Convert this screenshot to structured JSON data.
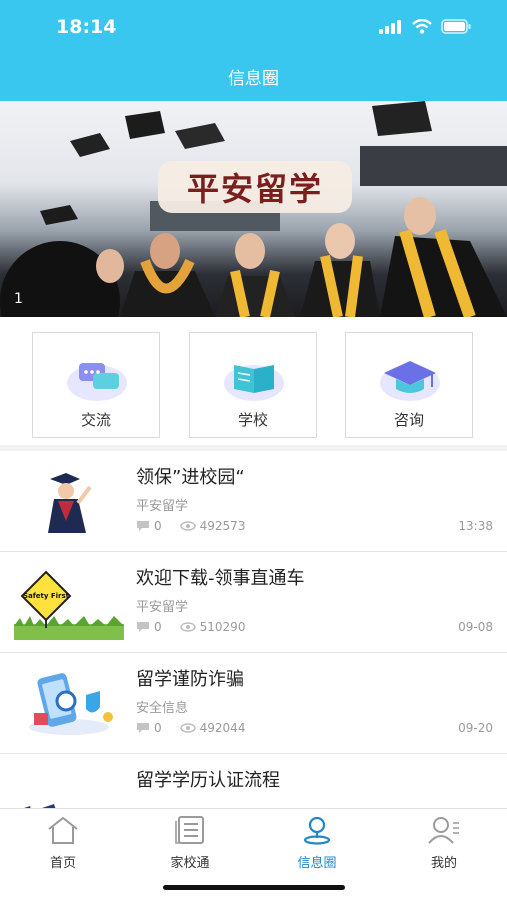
{
  "status": {
    "time": "18:14"
  },
  "header": {
    "title": "信息圈"
  },
  "banner": {
    "text": "平安留学",
    "index": "1"
  },
  "quick": [
    {
      "label": "交流",
      "icon": "chat-icon"
    },
    {
      "label": "学校",
      "icon": "book-icon"
    },
    {
      "label": "咨询",
      "icon": "graduation-cap-icon"
    }
  ],
  "news": [
    {
      "title": "领保”进校园“",
      "source": "平安留学",
      "comments": "0",
      "views": "492573",
      "date": "13:38"
    },
    {
      "title": "欢迎下载-领事直通车",
      "source": "平安留学",
      "comments": "0",
      "views": "510290",
      "date": "09-08"
    },
    {
      "title": "留学谨防诈骗",
      "source": "安全信息",
      "comments": "0",
      "views": "492044",
      "date": "09-20"
    },
    {
      "title": "留学学历认证流程",
      "source": "",
      "comments": "",
      "views": "",
      "date": ""
    }
  ],
  "thumb_texts": {
    "safety": "Safety First"
  },
  "tabs": [
    {
      "label": "首页",
      "icon": "home-icon"
    },
    {
      "label": "家校通",
      "icon": "document-icon"
    },
    {
      "label": "信息圈",
      "icon": "location-icon",
      "active": true
    },
    {
      "label": "我的",
      "icon": "profile-icon"
    }
  ],
  "colors": {
    "header": "#39c7f0",
    "tab_active": "#1f88c9"
  }
}
